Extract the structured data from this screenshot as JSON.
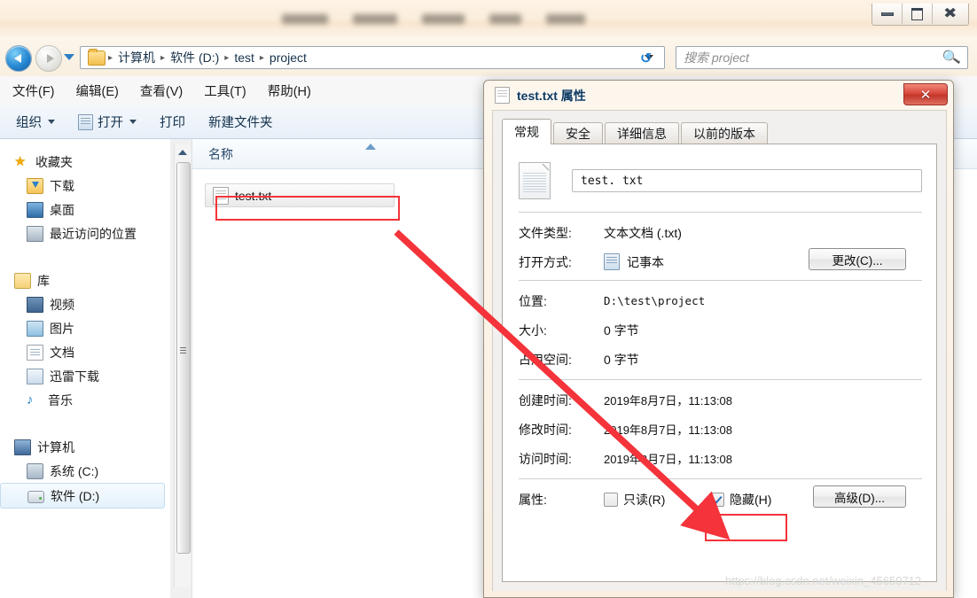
{
  "window": {
    "title_redacted": true,
    "controls": {
      "minimize": "minimize-icon",
      "maximize": "maximize-icon",
      "close": "close-icon"
    }
  },
  "address_bar": {
    "back_label": "back-icon",
    "forward_label": "forward-icon",
    "dropdown_label": "chevron-down-icon",
    "folder_icon": "folder-icon",
    "separator": "▸",
    "breadcrumbs": [
      "计算机",
      "软件 (D:)",
      "test",
      "project"
    ],
    "refresh_icon": "refresh-icon"
  },
  "search": {
    "placeholder": "搜索 project",
    "icon": "search-icon"
  },
  "menu": {
    "items": [
      "文件(F)",
      "编辑(E)",
      "查看(V)",
      "工具(T)",
      "帮助(H)"
    ]
  },
  "toolbar": {
    "organize": "组织",
    "open": "打开",
    "print": "打印",
    "new_folder": "新建文件夹"
  },
  "sidebar": {
    "groups": [
      {
        "header": {
          "label": "收藏夹",
          "icon": "star-icon"
        },
        "items": [
          {
            "label": "下载",
            "icon": "download-folder-icon"
          },
          {
            "label": "桌面",
            "icon": "desktop-icon"
          },
          {
            "label": "最近访问的位置",
            "icon": "recent-places-icon"
          }
        ]
      },
      {
        "header": {
          "label": "库",
          "icon": "library-icon"
        },
        "items": [
          {
            "label": "视频",
            "icon": "video-icon"
          },
          {
            "label": "图片",
            "icon": "picture-icon"
          },
          {
            "label": "文档",
            "icon": "document-icon"
          },
          {
            "label": "迅雷下载",
            "icon": "thunder-download-icon"
          },
          {
            "label": "音乐",
            "icon": "music-icon"
          }
        ]
      },
      {
        "header": {
          "label": "计算机",
          "icon": "computer-icon"
        },
        "items": [
          {
            "label": "系统 (C:)",
            "icon": "system-drive-icon",
            "selected": false
          },
          {
            "label": "软件 (D:)",
            "icon": "hard-drive-icon",
            "selected": true
          }
        ]
      }
    ]
  },
  "file_list": {
    "column_header": "名称",
    "sort_indicator": "sort-ascending-icon",
    "rows": [
      {
        "name": "test.txt",
        "icon": "text-file-icon",
        "highlighted": true
      }
    ]
  },
  "dialog": {
    "title": "test.txt 属性",
    "title_icon": "text-file-icon",
    "close_label": "✕",
    "tabs": [
      {
        "label": "常规",
        "active": true
      },
      {
        "label": "安全",
        "active": false
      },
      {
        "label": "详细信息",
        "active": false
      },
      {
        "label": "以前的版本",
        "active": false
      }
    ],
    "filename_value": "test. txt",
    "fields": [
      {
        "label": "文件类型:",
        "value": "文本文档 (.txt)"
      },
      {
        "label": "打开方式:",
        "value": "记事本",
        "icon": "notepad-icon",
        "button": "更改(C)..."
      },
      {
        "label": "位置:",
        "value": "D:\\test\\project"
      },
      {
        "label": "大小:",
        "value": "0 字节"
      },
      {
        "label": "占用空间:",
        "value": "0 字节"
      },
      {
        "label": "创建时间:",
        "value": "2019年8月7日，11:13:08"
      },
      {
        "label": "修改时间:",
        "value": "2019年8月7日，11:13:08"
      },
      {
        "label": "访问时间:",
        "value": "2019年8月7日，11:13:08"
      }
    ],
    "attributes": {
      "label": "属性:",
      "readonly": {
        "label": "只读(R)",
        "checked": false
      },
      "hidden": {
        "label": "隐藏(H)",
        "checked": true,
        "highlighted": true
      },
      "advanced_button": "高级(D)..."
    }
  },
  "annotation": {
    "arrow_color": "#f4333a",
    "highlight_color": "#f4333a",
    "arrow_from": "test.txt file row",
    "arrow_to": "隐藏(H) checkbox"
  },
  "watermark": {
    "text": "https://blog.csdn.net/weixin_45650712"
  }
}
